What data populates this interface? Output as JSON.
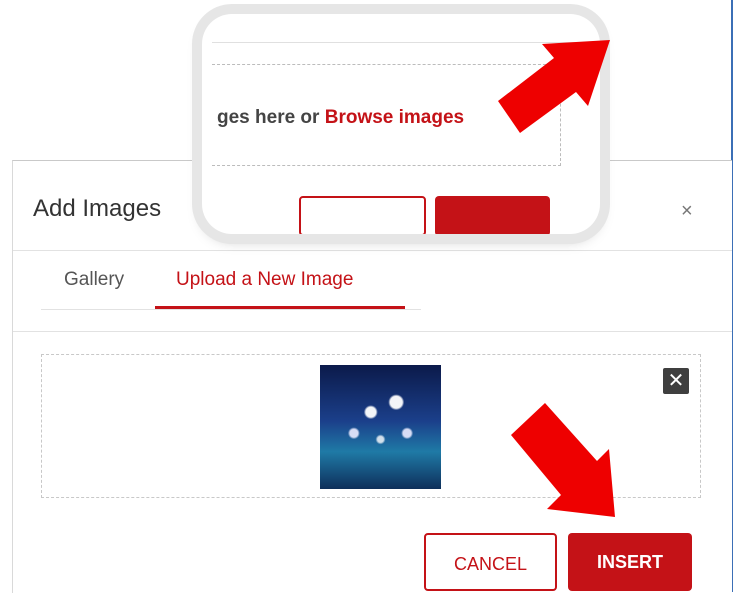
{
  "dialog": {
    "title": "Add Images",
    "close_symbol": "×",
    "tabs": [
      {
        "label": "Gallery",
        "active": false
      },
      {
        "label": "Upload a New Image",
        "active": true
      }
    ],
    "dropzone": {
      "thumbnail_icon": "uploaded-image-thumbnail",
      "remove_symbol": "✕"
    },
    "buttons": {
      "cancel_label": "CANCEL",
      "insert_label": "INSERT"
    }
  },
  "callout": {
    "prefix_text": "ges here or ",
    "link_text": "Browse images"
  },
  "annotations": {
    "arrow_color": "#ee0000"
  },
  "colors": {
    "accent": "#c41217",
    "edge": "#3b6fb6"
  }
}
